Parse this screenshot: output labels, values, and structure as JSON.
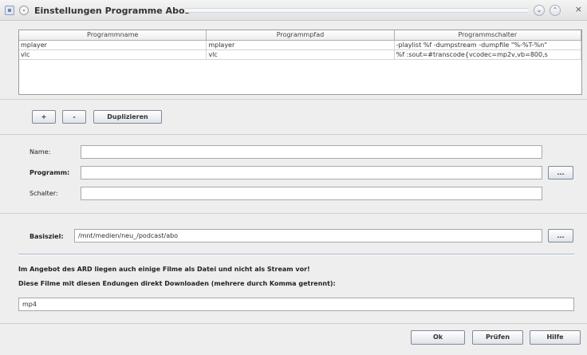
{
  "window": {
    "title": "Einstellungen Programme Abos",
    "icons": [
      "window-icon",
      "pin-icon",
      "minimize-icon",
      "maximize-icon",
      "close-icon"
    ],
    "buttons": {
      "minimize": "⌄",
      "maximize": "⌃",
      "close": "×"
    }
  },
  "table": {
    "columns": [
      "Programmname",
      "Programmpfad",
      "Programmschalter"
    ],
    "rows": [
      [
        "mplayer",
        "mplayer",
        "-playlist %f -dumpstream -dumpfile \"%-%T-%n\""
      ],
      [
        "vlc",
        "vlc",
        "%f :sout=#transcode{vcodec=mp2v,vb=800,s"
      ]
    ]
  },
  "table_buttons": {
    "add": "+",
    "remove": "-",
    "duplicate": "Duplizieren"
  },
  "form": {
    "name_label": "Name:",
    "name_value": "",
    "program_label": "Programm:",
    "program_value": "",
    "program_browse": "...",
    "switch_label": "Schalter:",
    "switch_value": ""
  },
  "target": {
    "label": "Basisziel:",
    "value": "/mnt/medien/neu_/podcast/abo",
    "browse": "..."
  },
  "info": {
    "line1": "Im Angebot des ARD liegen auch einige Filme als Datei und nicht als Stream vor!",
    "line2": "Diese Filme mit diesen Endungen direkt Downloaden (mehrere durch Komma getrennt):",
    "extensions": "mp4"
  },
  "footer": {
    "ok": "Ok",
    "check": "Prüfen",
    "help": "Hilfe"
  }
}
